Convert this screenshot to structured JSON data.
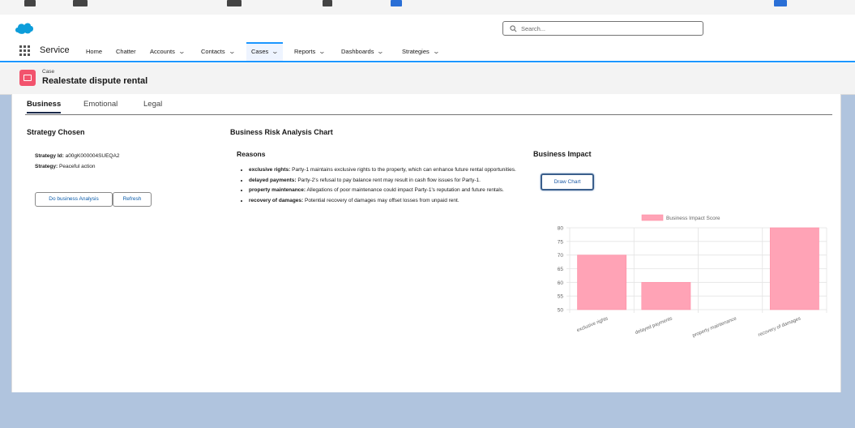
{
  "app": {
    "name": "Service"
  },
  "search": {
    "placeholder": "Search..."
  },
  "nav": [
    {
      "label": "Home",
      "dropdown": false
    },
    {
      "label": "Chatter",
      "dropdown": false
    },
    {
      "label": "Accounts",
      "dropdown": true
    },
    {
      "label": "Contacts",
      "dropdown": true
    },
    {
      "label": "Cases",
      "dropdown": true,
      "active": true
    },
    {
      "label": "Reports",
      "dropdown": true
    },
    {
      "label": "Dashboards",
      "dropdown": true
    },
    {
      "label": "Strategies",
      "dropdown": true
    }
  ],
  "record": {
    "object_label": "Case",
    "title": "Realestate dispute rental"
  },
  "tabs": [
    "Business",
    "Emotional",
    "Legal"
  ],
  "strategy": {
    "section_title": "Strategy Chosen",
    "id_label": "Strategy Id:",
    "id_value": "a00gK000004SUEQA2",
    "name_label": "Strategy:",
    "name_value": "Peaceful action",
    "analysis_button": "Do business Analysis",
    "refresh_button": "Refresh"
  },
  "risk": {
    "section_title": "Business Risk Analysis Chart",
    "reasons_title": "Reasons",
    "reasons": [
      {
        "term": "exclusive rights:",
        "text": " Party-1 maintains exclusive rights to the property, which can enhance future rental opportunities."
      },
      {
        "term": "delayed payments:",
        "text": " Party-2's refusal to pay balance rent may result in cash flow issues for Party-1."
      },
      {
        "term": "property maintenance:",
        "text": " Allegations of poor maintenance could impact Party-1's reputation and future rentals."
      },
      {
        "term": "recovery of damages:",
        "text": " Potential recovery of damages may offset losses from unpaid rent."
      }
    ]
  },
  "impact": {
    "section_title": "Business Impact",
    "draw_button": "Draw Chart"
  },
  "chart_data": {
    "type": "bar",
    "categories": [
      "exclusive rights",
      "delayed payments",
      "property maintenance",
      "recovery of damages"
    ],
    "series": [
      {
        "name": "Business Impact Score",
        "values": [
          70,
          60,
          50,
          80
        ],
        "color": "#ffa3b6"
      }
    ],
    "ylim": [
      50,
      80
    ],
    "yticks": [
      50,
      55,
      60,
      65,
      70,
      75,
      80
    ],
    "grid": true,
    "legend": "top",
    "title": "",
    "xlabel": "",
    "ylabel": ""
  },
  "colors": {
    "brand_blue": "#1b96ff",
    "case_icon": "#f2536d",
    "bar": "#ffa3b6"
  }
}
